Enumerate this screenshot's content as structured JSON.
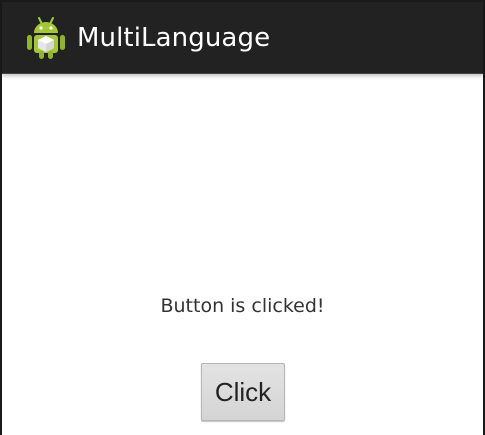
{
  "action_bar": {
    "icon": "android-robot-icon",
    "title": "MultiLanguage",
    "background": "#222222"
  },
  "content": {
    "status_text": "Button is clicked!",
    "button_label": "Click"
  }
}
